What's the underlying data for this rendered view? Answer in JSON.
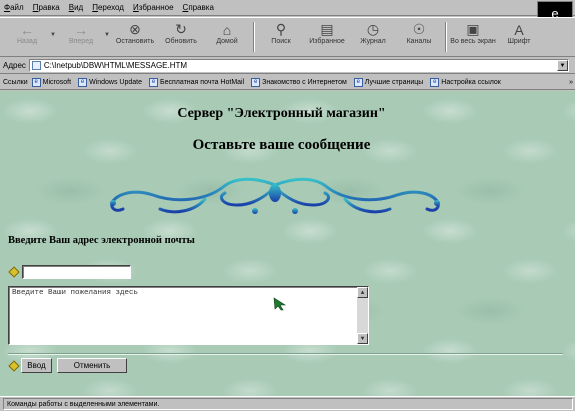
{
  "menubar": {
    "items": [
      "Файл",
      "Правка",
      "Вид",
      "Переход",
      "Избранное",
      "Справка"
    ]
  },
  "toolbar": {
    "buttons": [
      {
        "label": "Назад",
        "icon": "back-arrow-icon"
      },
      {
        "label": "Вперед",
        "icon": "forward-arrow-icon"
      },
      {
        "label": "Остановить",
        "icon": "stop-icon"
      },
      {
        "label": "Обновить",
        "icon": "refresh-icon"
      },
      {
        "label": "Домой",
        "icon": "home-icon"
      },
      {
        "label": "Поиск",
        "icon": "search-icon"
      },
      {
        "label": "Избранное",
        "icon": "favorites-icon"
      },
      {
        "label": "Журнал",
        "icon": "history-icon"
      },
      {
        "label": "Каналы",
        "icon": "channels-icon"
      },
      {
        "label": "Во весь экран",
        "icon": "fullscreen-icon"
      },
      {
        "label": "Шрифт",
        "icon": "font-icon"
      }
    ]
  },
  "address": {
    "label": "Адрес",
    "value": "C:\\Inetpub\\DBW\\HTML\\MESSAGE.HTM"
  },
  "links": {
    "label": "Ссылки",
    "items": [
      "Microsoft",
      "Windows Update",
      "Бесплатная почта HotMail",
      "Знакомство с Интернетом",
      "Лучшие страницы",
      "Настройка ссылок"
    ],
    "more": "»"
  },
  "page": {
    "title": "Сервер \"Электронный магазин\"",
    "subtitle": "Оставьте ваше сообщение",
    "email_label": "Введите Ваш адрес электронной почты",
    "email_value": "",
    "message_text": "Введите Ваши пожелания здесь",
    "submit_label": "Ввод",
    "reset_label": "Отменить"
  },
  "status": {
    "text": "Команды работы с выделенными элементами."
  },
  "colors": {
    "page_background": "#a9cbb6",
    "ornament_blue": "#1a4fa8",
    "ornament_teal": "#2aa8b8"
  }
}
